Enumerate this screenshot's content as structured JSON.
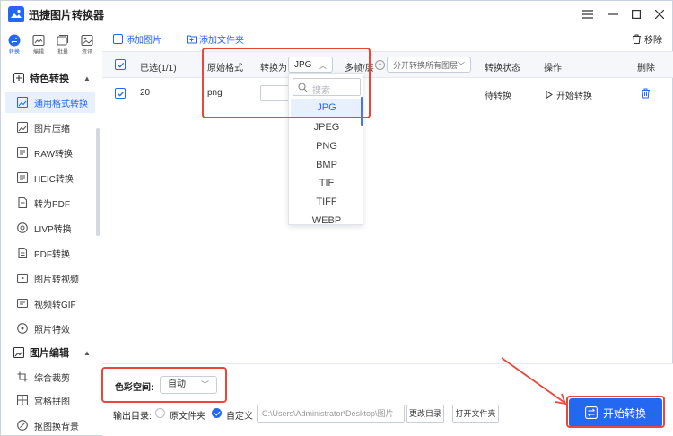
{
  "app": {
    "title": "迅捷图片转换器",
    "brand_color": "#2468f2",
    "highlight_color": "#e8483b"
  },
  "window_controls": {
    "menu_icon": "menu-icon",
    "minimize_icon": "minimize-icon",
    "maximize_icon": "maximize-icon",
    "close_icon": "close-icon"
  },
  "rail": [
    {
      "label": "转换",
      "icon": "convert-icon",
      "active": true
    },
    {
      "label": "编辑",
      "icon": "edit-icon",
      "active": false
    },
    {
      "label": "批量",
      "icon": "batch-icon",
      "active": false
    },
    {
      "label": "资讯",
      "icon": "image-info-icon",
      "active": false
    }
  ],
  "sidebar": {
    "group1": {
      "label": "特色转换",
      "chevron": "▲"
    },
    "items": [
      {
        "label": "通用格式转换",
        "icon": "image-icon",
        "active": true
      },
      {
        "label": "图片压缩",
        "icon": "compress-icon"
      },
      {
        "label": "RAW转换",
        "icon": "raw-icon"
      },
      {
        "label": "HEIC转换",
        "icon": "heic-icon"
      },
      {
        "label": "转为PDF",
        "icon": "pdf-icon"
      },
      {
        "label": "LIVP转换",
        "icon": "livp-icon"
      },
      {
        "label": "PDF转换",
        "icon": "pdf-convert-icon"
      },
      {
        "label": "图片转视频",
        "icon": "video-icon"
      },
      {
        "label": "视频转GIF",
        "icon": "gif-icon"
      },
      {
        "label": "照片特效",
        "icon": "effect-icon"
      }
    ],
    "group2": {
      "label": "图片编辑",
      "chevron": "▲"
    },
    "items2": [
      {
        "label": "综合裁剪",
        "icon": "crop-icon"
      },
      {
        "label": "宫格拼图",
        "icon": "grid-icon"
      },
      {
        "label": "抠图换背景",
        "icon": "cutout-icon"
      }
    ]
  },
  "toolbar": {
    "add_image": "添加图片",
    "add_folder": "添加文件夹",
    "remove": "移除"
  },
  "table": {
    "headers": {
      "selected": "已选(1/1)",
      "original_format": "原始格式",
      "convert_to": "转换为",
      "convert_value": "JPG",
      "multi_frame": "多帧/层",
      "multi_frame_select": "分开转换所有图层",
      "status": "转换状态",
      "action": "操作",
      "delete": "删除"
    },
    "rows": [
      {
        "index": "20",
        "format": "png",
        "status": "待转换",
        "action": "开始转换"
      }
    ]
  },
  "dropdown": {
    "search_placeholder": "搜索",
    "options": [
      "JPG",
      "JPEG",
      "PNG",
      "BMP",
      "TIF",
      "TIFF",
      "WEBP"
    ],
    "selected": "JPG"
  },
  "bottom": {
    "color_space_label": "色彩空间:",
    "color_space_value": "自动",
    "output_label": "输出目录:",
    "radio_original": "原文件夹",
    "radio_custom": "自定义",
    "path": "C:\\Users\\Administrator\\Desktop\\图片",
    "change_dir": "更改目录",
    "open_folder": "打开文件夹",
    "start": "开始转换"
  }
}
